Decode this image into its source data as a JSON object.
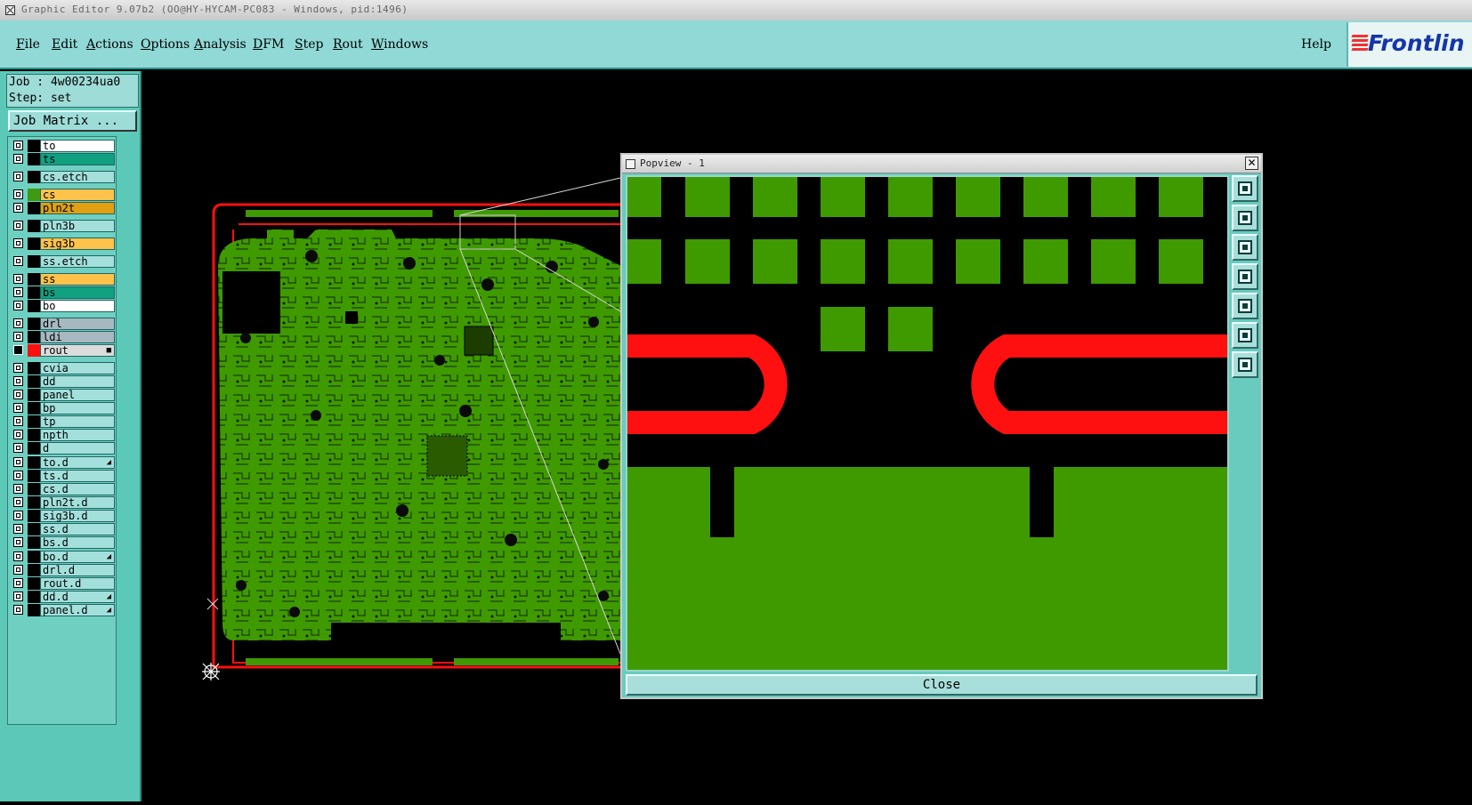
{
  "window": {
    "title": "Graphic Editor 9.07b2 (OO@HY-HYCAM-PC083 - Windows, pid:1496)"
  },
  "menu": [
    {
      "label": "File",
      "key": "F"
    },
    {
      "label": "Edit",
      "key": "E"
    },
    {
      "label": "Actions",
      "key": "A"
    },
    {
      "label": "Options",
      "key": "O"
    },
    {
      "label": "Analysis",
      "key": "A"
    },
    {
      "label": "DFM",
      "key": "D"
    },
    {
      "label": "Step",
      "key": "S"
    },
    {
      "label": "Rout",
      "key": "R"
    },
    {
      "label": "Windows",
      "key": "W"
    }
  ],
  "help_label": "Help",
  "logo_text": "Frontlin",
  "job": {
    "job_line": "Job : 4w00234ua0",
    "step_line": "Step: set"
  },
  "job_matrix_label": "Job Matrix ...",
  "layers": [
    {
      "name": "to",
      "color": "#ffffff",
      "swatch": "#000000"
    },
    {
      "name": "ts",
      "color": "#11a080",
      "swatch": "#000000"
    },
    {
      "name": "cs.etch",
      "color": "#a3e0dc",
      "swatch": "#000000"
    },
    {
      "name": "cs",
      "color": "#ffc24a",
      "swatch": "#3f9a12"
    },
    {
      "name": "pln2t",
      "color": "#e0a012",
      "swatch": "#000000"
    },
    {
      "name": "pln3b",
      "color": "#a3e0dc",
      "swatch": "#000000"
    },
    {
      "name": "sig3b",
      "color": "#ffc24a",
      "swatch": "#000000"
    },
    {
      "name": "ss.etch",
      "color": "#a3e0dc",
      "swatch": "#000000"
    },
    {
      "name": "ss",
      "color": "#ffc24a",
      "swatch": "#000000"
    },
    {
      "name": "bs",
      "color": "#11a080",
      "swatch": "#000000"
    },
    {
      "name": "bo",
      "color": "#ffffff",
      "swatch": "#000000"
    },
    {
      "name": "drl",
      "color": "#a8b8c0",
      "swatch": "#000000"
    },
    {
      "name": "ldi",
      "color": "#a8b8c0",
      "swatch": "#000000"
    },
    {
      "name": "rout",
      "color": "#dcdcdc",
      "swatch": "#ff1010",
      "active": true,
      "flag": "■"
    },
    {
      "name": "cvia",
      "color": "#a3e0dc",
      "swatch": "#000000"
    },
    {
      "name": "dd",
      "color": "#a3e0dc",
      "swatch": "#000000"
    },
    {
      "name": "panel",
      "color": "#a3e0dc",
      "swatch": "#000000"
    },
    {
      "name": "bp",
      "color": "#a3e0dc",
      "swatch": "#000000"
    },
    {
      "name": "tp",
      "color": "#a3e0dc",
      "swatch": "#000000"
    },
    {
      "name": "npth",
      "color": "#a3e0dc",
      "swatch": "#000000"
    },
    {
      "name": "d",
      "color": "#a3e0dc",
      "swatch": "#000000"
    },
    {
      "name": "to.d",
      "color": "#a3e0dc",
      "swatch": "#000000",
      "flag": "◢"
    },
    {
      "name": "ts.d",
      "color": "#a3e0dc",
      "swatch": "#000000"
    },
    {
      "name": "cs.d",
      "color": "#a3e0dc",
      "swatch": "#000000"
    },
    {
      "name": "pln2t.d",
      "color": "#a3e0dc",
      "swatch": "#000000"
    },
    {
      "name": "sig3b.d",
      "color": "#a3e0dc",
      "swatch": "#000000"
    },
    {
      "name": "ss.d",
      "color": "#a3e0dc",
      "swatch": "#000000"
    },
    {
      "name": "bs.d",
      "color": "#a3e0dc",
      "swatch": "#000000"
    },
    {
      "name": "bo.d",
      "color": "#a3e0dc",
      "swatch": "#000000",
      "flag": "◢"
    },
    {
      "name": "drl.d",
      "color": "#a3e0dc",
      "swatch": "#000000"
    },
    {
      "name": "rout.d",
      "color": "#a3e0dc",
      "swatch": "#000000"
    },
    {
      "name": "dd.d",
      "color": "#a3e0dc",
      "swatch": "#000000",
      "flag": "◢"
    },
    {
      "name": "panel.d",
      "color": "#a3e0dc",
      "swatch": "#000000",
      "flag": "◢"
    }
  ],
  "popview": {
    "title": "Popview - 1",
    "close_label": "Close",
    "close_x": "✕"
  },
  "colors": {
    "copper": "#3f9a00",
    "rout": "#ff1010",
    "accent": "#90d9d6"
  },
  "popview_tools": [
    "zoom-window-icon",
    "pan-up-icon",
    "pan-down-icon",
    "pan-left-icon",
    "pan-right-icon",
    "zoom-fit-icon",
    "zoom-home-icon"
  ]
}
